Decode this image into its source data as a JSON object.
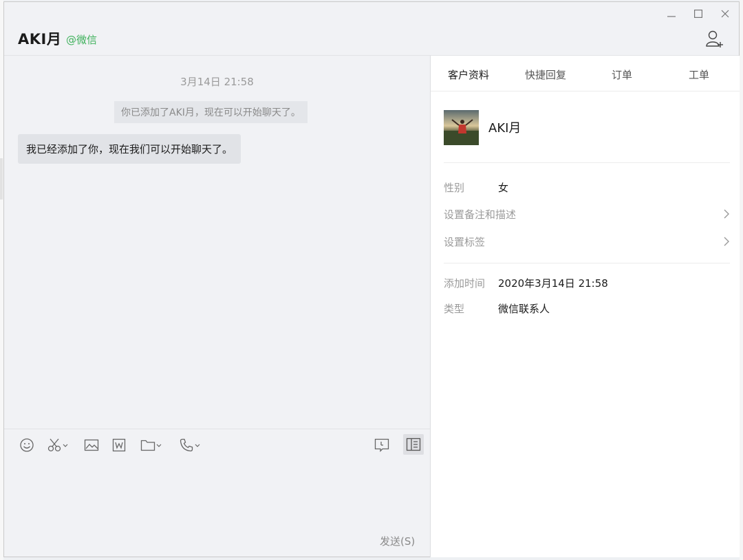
{
  "header": {
    "contact_name": "AKI月",
    "contact_source": "@微信"
  },
  "chat": {
    "timestamp": "3月14日 21:58",
    "system_message": "你已添加了AKI月，现在可以开始聊天了。",
    "messages": [
      {
        "text": "我已经添加了你，现在我们可以开始聊天了。"
      }
    ],
    "send_label": "发送(S)"
  },
  "tabs": [
    {
      "label": "客户资料",
      "active": true
    },
    {
      "label": "快捷回复",
      "active": false
    },
    {
      "label": "订单",
      "active": false
    },
    {
      "label": "工单",
      "active": false
    }
  ],
  "profile": {
    "name": "AKI月",
    "gender_label": "性别",
    "gender_value": "女",
    "remark_label": "设置备注和描述",
    "tag_label": "设置标签",
    "added_time_label": "添加时间",
    "added_time_value": "2020年3月14日 21:58",
    "type_label": "类型",
    "type_value": "微信联系人"
  },
  "icons": {
    "window_controls": [
      "minimize-icon",
      "maximize-icon",
      "close-icon"
    ],
    "header": "add-contact-icon",
    "toolbar": [
      "emoji-icon",
      "scissors-icon",
      "image-icon",
      "word-doc-icon",
      "folder-icon",
      "phone-icon",
      "chat-history-icon",
      "sidebar-toggle-icon"
    ]
  },
  "colors": {
    "source_green": "#3eb15b",
    "bubble_bg": "#e1e3e7",
    "panel_bg": "#f1f2f5"
  }
}
